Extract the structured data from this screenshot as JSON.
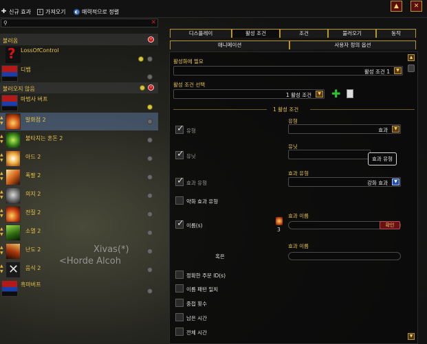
{
  "toolbar": {
    "new_aura": "신규 효과",
    "import": "가져오기",
    "sort": "매력적으로 정렬"
  },
  "left_list": [
    {
      "kind": "group",
      "label": "불러옴"
    },
    {
      "kind": "item",
      "label": "LossOfControl",
      "icon": "question-mark-icon",
      "sel": false
    },
    {
      "kind": "item",
      "label": "디뱀",
      "icon": "group-icon",
      "sel": false
    },
    {
      "kind": "group",
      "label": "불러오지 않음"
    },
    {
      "kind": "item",
      "label": "마법사 버프",
      "icon": "group-icon",
      "sel": false
    },
    {
      "kind": "item",
      "label": "발화점 2",
      "icon": "fire-icon",
      "sel": true
    },
    {
      "kind": "item",
      "label": "불타치는 혼돈 2",
      "icon": "green-flame-icon",
      "sel": false
    },
    {
      "kind": "item",
      "label": "아드 2",
      "icon": "orb-icon",
      "sel": false
    },
    {
      "kind": "item",
      "label": "폭팔 2",
      "icon": "fire-icon",
      "sel": false
    },
    {
      "kind": "item",
      "label": "의지 2",
      "icon": "skull-icon",
      "sel": false
    },
    {
      "kind": "item",
      "label": "전질 2",
      "icon": "fire-icon",
      "sel": false
    },
    {
      "kind": "item",
      "label": "소멸 2",
      "icon": "green-flame-icon",
      "sel": false
    },
    {
      "kind": "item",
      "label": "난도 2",
      "icon": "fire-icon",
      "sel": false
    },
    {
      "kind": "item",
      "label": "음식 2",
      "icon": "cross-icon",
      "sel": false
    },
    {
      "kind": "item",
      "label": "흑마버프",
      "icon": "group-icon",
      "sel": false
    }
  ],
  "ghost_text": [
    "Xivas(*)",
    "<Horde Alcoh"
  ],
  "tabs_row1": [
    "디스플레이",
    "활성 조건",
    "조건",
    "불러오기",
    "동작"
  ],
  "tabs_row2": [
    "애니메이션",
    "사용자 정의 옵션"
  ],
  "form": {
    "required_label": "활성화에 필요",
    "required_value": "활성 조건 1",
    "select_label": "활성 조건 선택",
    "select_value": "1 활성 조건",
    "section_title": "1 활성 조건",
    "type_chk_label": "유형",
    "type_label": "유형",
    "type_value": "효과",
    "unit_chk_label": "유닛",
    "unit_label": "유닛",
    "aura_type_chk_label": "효과 유형",
    "aura_type_label": "효과 유형",
    "aura_type_value": "강화 효과",
    "tooltip": "효과 유형",
    "debuff_chk_label": "약화 효과 유형",
    "name_chk_label": "이름(s)",
    "name_label": "효과 이름",
    "confirm": "확인",
    "or_label": "혹은",
    "name_label2": "효과 이름",
    "exact_spellid": "정확한 주문 ID(s)",
    "name_pattern": "이름 패턴 일치",
    "stack_count": "중첩 횟수",
    "remaining_time": "남은 시간",
    "total_time": "전체 시간",
    "icon_count": "3"
  }
}
